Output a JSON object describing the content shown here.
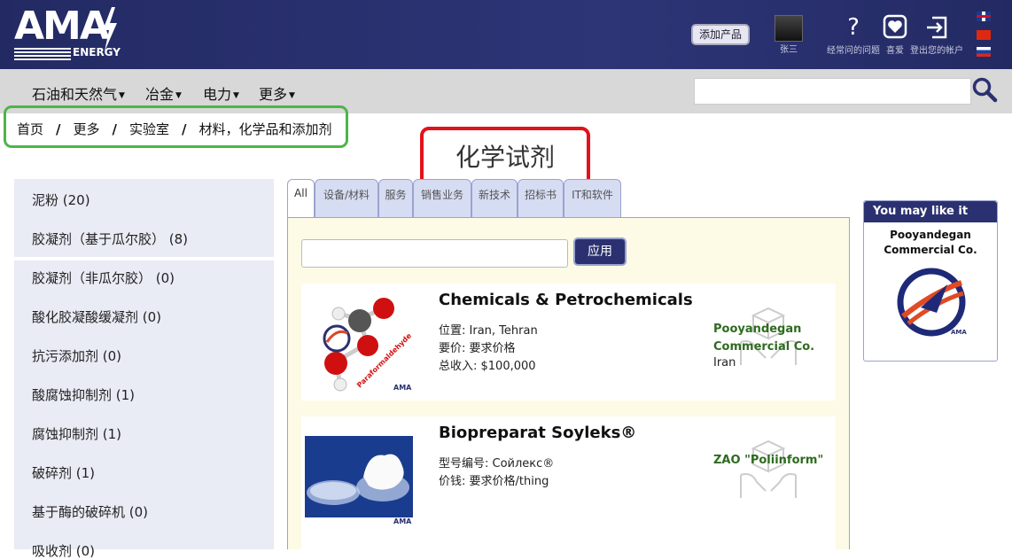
{
  "header": {
    "logo_text": "AMA",
    "logo_sub": "ENERGY",
    "add_product": "添加产品",
    "user_name": "张三",
    "faq_label": "经常问的问题",
    "favorites_label": "喜爱",
    "logout_label": "登出您的帐户",
    "colors": {
      "header_bg": "#2d3577",
      "accent": "#2b3170"
    }
  },
  "nav": {
    "items": [
      "石油和天然气",
      "冶金",
      "电力",
      "更多"
    ],
    "search_value": ""
  },
  "breadcrumb": [
    "首页",
    "更多",
    "实验室",
    "材料，化学品和添加剂"
  ],
  "page_title": "化学试剂",
  "sidebar": {
    "items": [
      "泥粉 (20)",
      "胶凝剂（基于瓜尔胶） (8)",
      "胶凝剂（非瓜尔胶） (0)",
      "酸化胶凝酸缓凝剂 (0)",
      "抗污添加剂 (0)",
      "酸腐蚀抑制剂 (1)",
      "腐蚀抑制剂 (1)",
      "破碎剂 (1)",
      "基于酶的破碎机 (0)",
      "吸收剂 (0)"
    ]
  },
  "tabs": [
    "All",
    "设备/材料",
    "服务",
    "销售业务",
    "新技术",
    "招标书",
    "IT和软件"
  ],
  "filter": {
    "value": "",
    "apply_label": "应用"
  },
  "products": [
    {
      "title": "Chemicals & Petrochemicals",
      "lines": [
        "位置: Iran, Tehran",
        "要价: 要求价格",
        "总收入: $100,000"
      ],
      "seller": [
        "Pooyandegan",
        "Commercial Co."
      ],
      "country": "Iran",
      "image_caption": "Paraformaldehyde",
      "image_mark": "AMA"
    },
    {
      "title": "Biopreparat Soyleks®",
      "lines": [
        "型号编号: Сойлекс®",
        "价钱: 要求价格/thing"
      ],
      "seller": [
        "ZAO \"Poliinform\""
      ],
      "country": "",
      "image_mark": "AMA"
    }
  ],
  "ad": {
    "heading": "You may like it",
    "company": [
      "Pooyandegan",
      "Commercial Co."
    ],
    "logo_mark": "AMA"
  }
}
